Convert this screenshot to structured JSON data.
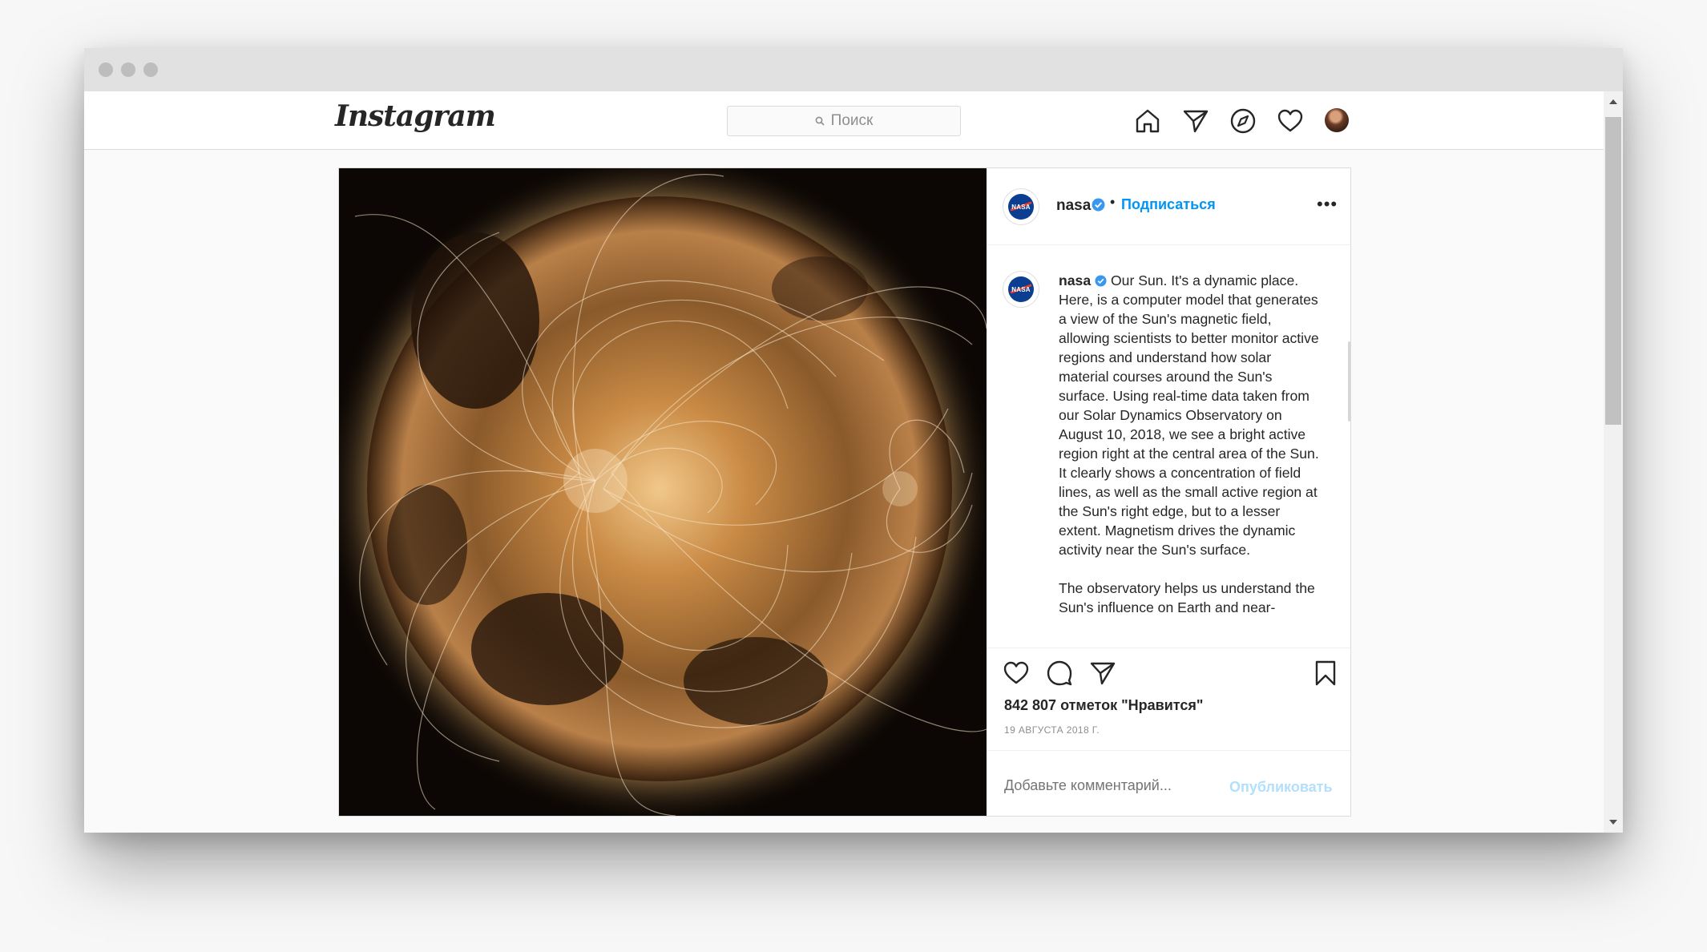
{
  "topnav": {
    "logo": "Instagram",
    "search_placeholder": "Поиск",
    "icons": [
      "home-icon",
      "direct-icon",
      "explore-icon",
      "activity-heart-icon",
      "profile-avatar"
    ]
  },
  "post": {
    "author": "nasa",
    "follow_separator": "•",
    "follow_label": "Подписаться",
    "more_label": "•••",
    "caption_user": "nasa",
    "caption_text": " Our Sun. It's a dynamic place. Here, is a computer model that generates a view of the Sun's magnetic field, allowing scientists to better monitor active regions and understand how solar material courses around the Sun's surface. Using real-time data taken from our Solar Dynamics Observatory on August 10, 2018, we see a bright active region right at the central area of the Sun. It clearly shows a concentration of field lines, as well as the small active region at the Sun's right edge, but to a lesser extent. Magnetism drives the dynamic activity near the Sun's surface.\n\nThe observatory helps us understand the Sun's influence on Earth and near-",
    "likes": "842 807 отметок \"Нравится\"",
    "date": "19 АВГУСТА 2018 Г.",
    "comment_placeholder": "Добавьте комментарий...",
    "publish_label": "Опубликовать",
    "logo_text": "NASA"
  },
  "colors": {
    "accent": "#0095f6",
    "publish_disabled": "#b2dffc",
    "verified": "#3897f0",
    "text": "#262626",
    "muted": "#8e8e8e"
  }
}
